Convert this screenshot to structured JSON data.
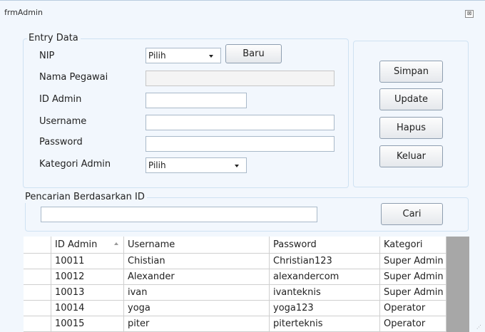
{
  "window": {
    "title": "frmAdmin",
    "close_glyph": "⊠"
  },
  "entry": {
    "legend": "Entry Data",
    "nip_label": "NIP",
    "nip_value": "Pilih",
    "baru_button": "Baru",
    "nama_label": "Nama Pegawai",
    "nama_value": "",
    "id_label": "ID Admin",
    "id_value": "",
    "username_label": "Username",
    "username_value": "",
    "password_label": "Password",
    "password_value": "",
    "kategori_label": "Kategori Admin",
    "kategori_value": "Pilih"
  },
  "actions": {
    "simpan": "Simpan",
    "update": "Update",
    "hapus": "Hapus",
    "keluar": "Keluar"
  },
  "search": {
    "legend": "Pencarian Berdasarkan ID",
    "value": "",
    "button": "Cari"
  },
  "grid": {
    "columns": [
      "ID Admin",
      "Username",
      "Password",
      "Kategori"
    ],
    "sorted_column": "ID Admin",
    "rows": [
      [
        "10011",
        "Chistian",
        "Christian123",
        "Super Admin"
      ],
      [
        "10012",
        "Alexander",
        "alexandercom",
        "Super Admin"
      ],
      [
        "10013",
        "ivan",
        "ivanteknis",
        "Super Admin"
      ],
      [
        "10014",
        "yoga",
        "yoga123",
        "Operator"
      ],
      [
        "10015",
        "piter",
        "piterteknis",
        "Operator"
      ]
    ]
  },
  "icons": {
    "combo_arrow": "chevron-down-icon",
    "sort": "sort-ascending-icon",
    "grip": "resize-grip-icon"
  }
}
